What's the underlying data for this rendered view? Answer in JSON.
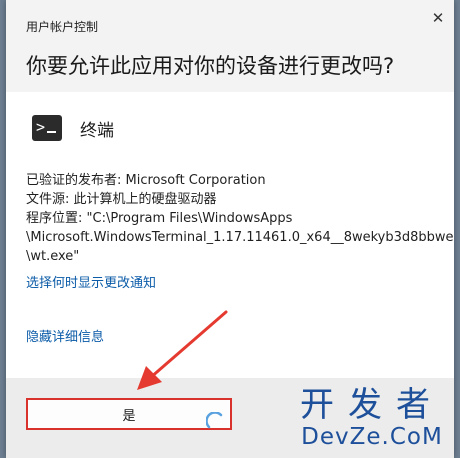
{
  "window": {
    "title": "用户帐户控制",
    "question": "你要允许此应用对你的设备进行更改吗?"
  },
  "app": {
    "name": "终端",
    "icon": "terminal-icon"
  },
  "details": {
    "publisher": "已验证的发布者: Microsoft Corporation",
    "origin": "文件源: 此计算机上的硬盘驱动器",
    "location_line1": "程序位置: \"C:\\Program Files\\WindowsApps",
    "location_line2": "\\Microsoft.WindowsTerminal_1.17.11461.0_x64__8wekyb3d8bbwe",
    "location_line3": "\\wt.exe\""
  },
  "links": {
    "change_notification": "选择何时显示更改通知",
    "hide_details": "隐藏详细信息"
  },
  "buttons": {
    "yes": "是"
  },
  "watermark": {
    "cn": "开发者",
    "en": "DevZe.CoM"
  },
  "colors": {
    "accent": "#d9322c",
    "link": "#0b5ba8",
    "watermark": "#1d4f9a"
  }
}
